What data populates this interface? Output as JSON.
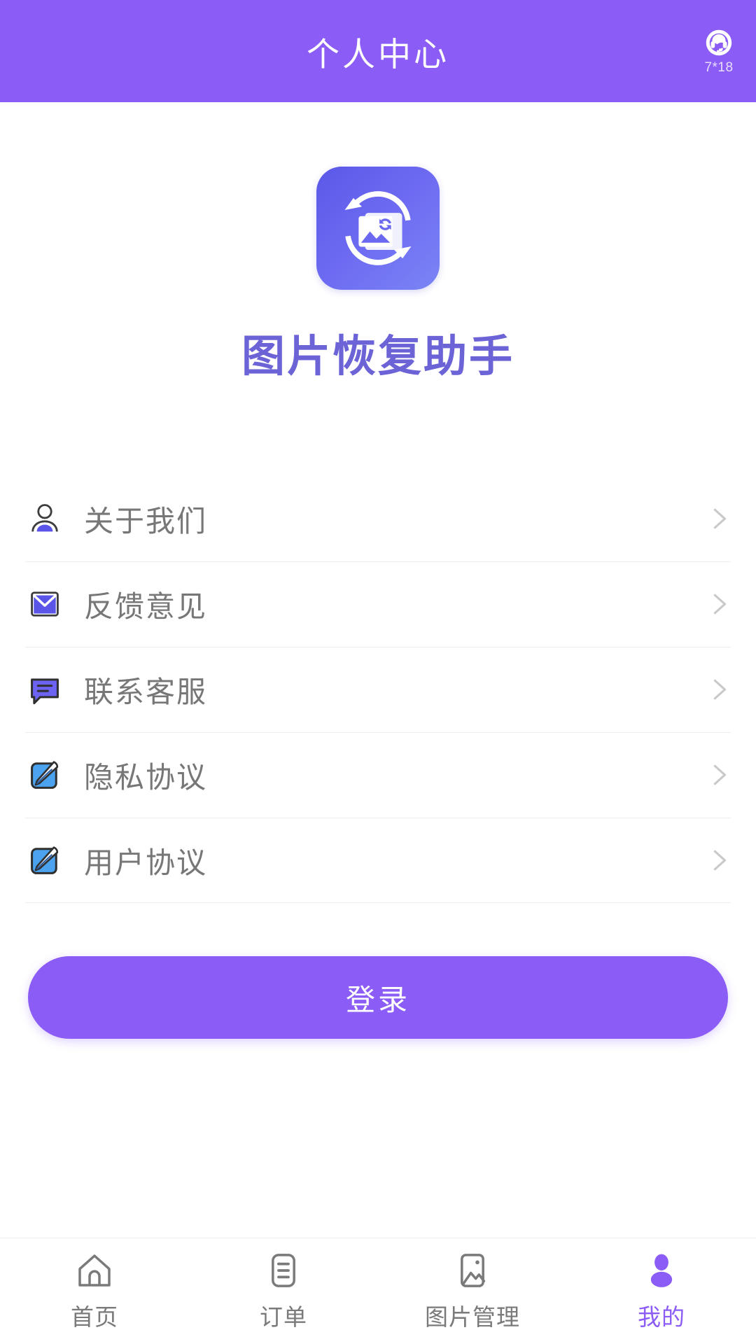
{
  "header": {
    "title": "个人中心",
    "service_icon": "headset-support-icon",
    "service_label": "7*18",
    "background_color": "#8B5CF6",
    "title_color": "#FFFFFF"
  },
  "brand": {
    "logo_icon": "photo-recovery-logo-icon",
    "logo_gradient_from": "#5B58E8",
    "logo_gradient_to": "#7A85F5",
    "app_name": "图片恢复助手",
    "app_name_color": "#6B63D6"
  },
  "menu": {
    "items": [
      {
        "label": "关于我们",
        "icon": "user-profile-icon",
        "chevron": "chevron-right-icon"
      },
      {
        "label": "反馈意见",
        "icon": "envelope-mail-icon",
        "chevron": "chevron-right-icon"
      },
      {
        "label": "联系客服",
        "icon": "chat-bubble-icon",
        "chevron": "chevron-right-icon"
      },
      {
        "label": "隐私协议",
        "icon": "edit-document-icon",
        "chevron": "chevron-right-icon"
      },
      {
        "label": "用户协议",
        "icon": "edit-document-icon",
        "chevron": "chevron-right-icon"
      }
    ]
  },
  "login": {
    "label": "登录",
    "background_color": "#8B5CF6",
    "text_color": "#FFFFFF"
  },
  "tabbar": {
    "active_color": "#8B5CF6",
    "inactive_color": "#7A7A7A",
    "tabs": [
      {
        "label": "首页",
        "icon": "home-icon",
        "active": false
      },
      {
        "label": "订单",
        "icon": "order-list-icon",
        "active": false
      },
      {
        "label": "图片管理",
        "icon": "image-manage-icon",
        "active": false
      },
      {
        "label": "我的",
        "icon": "person-icon",
        "active": true
      }
    ]
  }
}
